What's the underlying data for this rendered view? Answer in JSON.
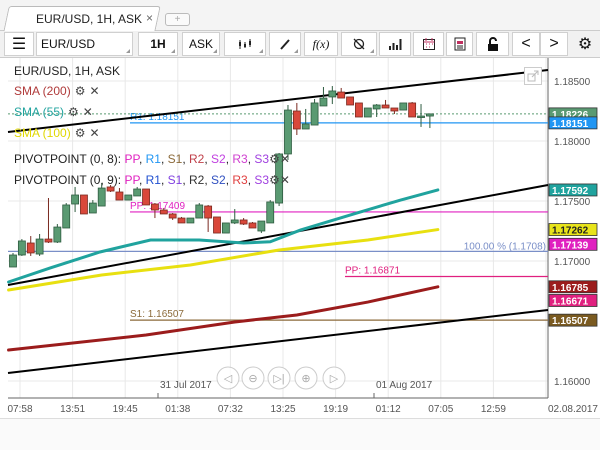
{
  "tab": {
    "title": "EUR/USD, 1H, ASK",
    "close": "×",
    "add": "+"
  },
  "toolbar": {
    "instrument": "EUR/USD",
    "period": "1H",
    "side": "ASK",
    "fx": "f(x)",
    "prev": "<",
    "next": ">"
  },
  "legend": {
    "title": "EUR/USD, 1H, ASK",
    "sma": [
      {
        "label": "SMA (200)",
        "color": "#b03a3a"
      },
      {
        "label": "SMA (55)",
        "color": "#20a39e"
      },
      {
        "label": "SMA (100)",
        "color": "#e0d800"
      }
    ],
    "pivots": [
      {
        "label": "PIVOTPOINT (0, 8):",
        "items": [
          {
            "t": "PP",
            "c": "#e020c0"
          },
          {
            "t": "R1",
            "c": "#2196f3"
          },
          {
            "t": "S1",
            "c": "#8b6a3a"
          },
          {
            "t": "R2",
            "c": "#c0404a"
          },
          {
            "t": "S2",
            "c": "#c040e0"
          },
          {
            "t": "R3",
            "c": "#d040d0"
          },
          {
            "t": "S3",
            "c": "#a040e0"
          }
        ]
      },
      {
        "label": "PIVOTPOINT (0, 9):",
        "items": [
          {
            "t": "PP",
            "c": "#e020c0"
          },
          {
            "t": "R1",
            "c": "#2050d0"
          },
          {
            "t": "S1",
            "c": "#8040e0"
          },
          {
            "t": "R2",
            "c": "#333333"
          },
          {
            "t": "S2",
            "c": "#3050c0"
          },
          {
            "t": "R3",
            "c": "#e04040"
          },
          {
            "t": "S3",
            "c": "#a040e0"
          }
        ]
      }
    ]
  },
  "chart_data": {
    "type": "candlestick",
    "price_axis": {
      "ticks": [
        "1.18500",
        "1.18000",
        "1.17500",
        "1.17000",
        "1.16000"
      ],
      "tick_values": [
        1.185,
        1.18,
        1.175,
        1.17,
        1.16
      ]
    },
    "time_axis": {
      "ticks": [
        "07:58",
        "13:51",
        "19:45",
        "01:38",
        "07:32",
        "13:25",
        "19:19",
        "01:12",
        "07:05",
        "12:59"
      ],
      "date_right": "02.08.2017",
      "day_markers": [
        "31 Jul 2017",
        "01 Aug 2017"
      ]
    },
    "candles": [
      [
        1.1695,
        1.17067,
        1.1695,
        1.1705
      ],
      [
        1.1705,
        1.17183,
        1.17042,
        1.17167
      ],
      [
        1.1715,
        1.17208,
        1.17042,
        1.17067
      ],
      [
        1.17058,
        1.17225,
        1.17042,
        1.17183
      ],
      [
        1.17183,
        1.17525,
        1.1715,
        1.17158
      ],
      [
        1.17158,
        1.17308,
        1.1715,
        1.17283
      ],
      [
        1.17275,
        1.17483,
        1.17275,
        1.17467
      ],
      [
        1.17475,
        1.17617,
        1.17408,
        1.1755
      ],
      [
        1.1755,
        1.1755,
        1.17392,
        1.17392
      ],
      [
        1.174,
        1.17508,
        1.174,
        1.17483
      ],
      [
        1.17458,
        1.1765,
        1.17458,
        1.17608
      ],
      [
        1.17617,
        1.17633,
        1.17575,
        1.17583
      ],
      [
        1.17575,
        1.17608,
        1.17508,
        1.17508
      ],
      [
        1.17508,
        1.1755,
        1.17508,
        1.1755
      ],
      [
        1.17542,
        1.17617,
        1.17542,
        1.176
      ],
      [
        1.176,
        1.176,
        1.17467,
        1.17467
      ],
      [
        1.17475,
        1.17483,
        1.17358,
        1.17425
      ],
      [
        1.17425,
        1.17442,
        1.17392,
        1.17392
      ],
      [
        1.17392,
        1.174,
        1.17342,
        1.17358
      ],
      [
        1.17358,
        1.17367,
        1.17317,
        1.17317
      ],
      [
        1.17317,
        1.17358,
        1.17317,
        1.17358
      ],
      [
        1.17358,
        1.17483,
        1.17358,
        1.17467
      ],
      [
        1.17458,
        1.17467,
        1.17242,
        1.17358
      ],
      [
        1.17367,
        1.17367,
        1.17233,
        1.17233
      ],
      [
        1.17233,
        1.17317,
        1.17233,
        1.17317
      ],
      [
        1.17317,
        1.17433,
        1.17308,
        1.17342
      ],
      [
        1.17342,
        1.17358,
        1.173,
        1.17308
      ],
      [
        1.17317,
        1.17325,
        1.17275,
        1.17275
      ],
      [
        1.1725,
        1.17333,
        1.17233,
        1.17333
      ],
      [
        1.17317,
        1.17508,
        1.17317,
        1.17492
      ],
      [
        1.17483,
        1.179,
        1.17458,
        1.17892
      ],
      [
        1.17892,
        1.183,
        1.17842,
        1.18258
      ],
      [
        1.1825,
        1.18317,
        1.1805,
        1.181
      ],
      [
        1.181,
        1.18267,
        1.181,
        1.18142
      ],
      [
        1.18133,
        1.1835,
        1.18133,
        1.18317
      ],
      [
        1.18292,
        1.1845,
        1.18292,
        1.18358
      ],
      [
        1.18367,
        1.18458,
        1.18308,
        1.18417
      ],
      [
        1.18408,
        1.18442,
        1.18358,
        1.18358
      ],
      [
        1.18367,
        1.18367,
        1.183,
        1.183
      ],
      [
        1.18317,
        1.18317,
        1.182,
        1.182
      ],
      [
        1.182,
        1.18275,
        1.182,
        1.18275
      ],
      [
        1.18267,
        1.18308,
        1.182,
        1.183
      ],
      [
        1.183,
        1.18342,
        1.18275,
        1.18275
      ],
      [
        1.18275,
        1.18275,
        1.18225,
        1.1825
      ],
      [
        1.18258,
        1.18317,
        1.18258,
        1.18317
      ],
      [
        1.18317,
        1.18325,
        1.182,
        1.182
      ],
      [
        1.182,
        1.18308,
        1.18117,
        1.18208
      ],
      [
        1.18208,
        1.18225,
        1.18108,
        1.18226
      ]
    ],
    "sma": [
      {
        "name": "SMA (55)",
        "color": "#20a39e",
        "points": [
          [
            -0.5,
            1.16825
          ],
          [
            4.2,
            1.16942
          ],
          [
            9.8,
            1.17075
          ],
          [
            15.5,
            1.17175
          ],
          [
            21,
            1.17175
          ],
          [
            26,
            1.1715
          ],
          [
            29,
            1.1716
          ],
          [
            32.4,
            1.17258
          ],
          [
            38,
            1.17383
          ],
          [
            43.7,
            1.17508
          ],
          [
            47.9,
            1.17592
          ]
        ]
      },
      {
        "name": "SMA (100)",
        "color": "#e8e010",
        "points": [
          [
            -0.5,
            1.16758
          ],
          [
            10,
            1.16883
          ],
          [
            20,
            1.16967
          ],
          [
            30,
            1.17092
          ],
          [
            40,
            1.17175
          ],
          [
            47.9,
            1.17262
          ]
        ]
      },
      {
        "name": "SMA (200)",
        "color": "#9b1c1c",
        "points": [
          [
            -0.5,
            1.16258
          ],
          [
            15,
            1.16383
          ],
          [
            25,
            1.16492
          ],
          [
            32,
            1.1655
          ],
          [
            40,
            1.16658
          ],
          [
            47.9,
            1.16785
          ]
        ]
      }
    ],
    "trendlines": [
      [
        1.18075,
        1.18592
      ],
      [
        1.168,
        1.17633
      ],
      [
        1.16067,
        1.16592
      ]
    ],
    "levels": [
      {
        "label": "R1: 1.18151",
        "value": 1.18151,
        "color": "#2196f3"
      },
      {
        "label": "PP: 1.17409",
        "value": 1.17409,
        "color": "#e020c0"
      },
      {
        "label": "PP: 1.16871",
        "value": 1.16871,
        "color": "#e0207f"
      },
      {
        "label": "S1: 1.16507",
        "value": 1.16507,
        "color": "#8b6a3a"
      },
      {
        "label": "100.00 % (1.1708)",
        "value": 1.1708,
        "color": "#7a8fc8"
      }
    ],
    "price_tags": [
      {
        "text": "1.18226",
        "value": 1.18226,
        "bg": "#5a9a72",
        "fg": "#fff"
      },
      {
        "text": "1.18151",
        "value": 1.18151,
        "bg": "#2196f3",
        "fg": "#fff"
      },
      {
        "text": "1.17592",
        "value": 1.17592,
        "bg": "#20a39e",
        "fg": "#fff"
      },
      {
        "text": "1.17262",
        "value": 1.17262,
        "bg": "#e8e41a",
        "fg": "#222"
      },
      {
        "text": "1.17139",
        "value": 1.17139,
        "bg": "#e020c0",
        "fg": "#fff"
      },
      {
        "text": "1.16785",
        "value": 1.16785,
        "bg": "#9b1c1c",
        "fg": "#fff"
      },
      {
        "text": "1.16671",
        "value": 1.16671,
        "bg": "#e0207f",
        "fg": "#fff"
      },
      {
        "text": "1.16507",
        "value": 1.16507,
        "bg": "#7a5a20",
        "fg": "#fff"
      }
    ],
    "last_price": 1.18226
  },
  "colors": {
    "up": "#5a9a72",
    "down": "#d9483b"
  }
}
